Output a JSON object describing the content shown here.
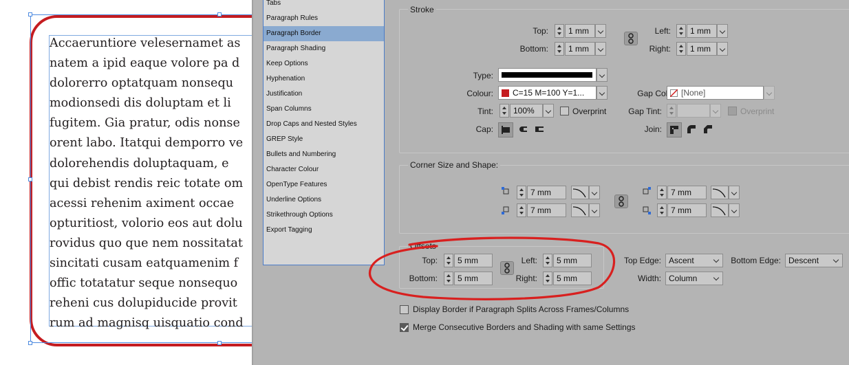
{
  "document": {
    "lines": [
      "Accaeruntiore velesernamet as",
      "natem a ipid eaque volore pa d",
      "dolorerro optatquam nonsequ",
      "modionsedi dis doluptam et li",
      "fugitem. Gia pratur, odis nonse",
      "orent labo. Itatqui demporro ve",
      "dolorehendis doluptaquam, e",
      "qui debist rendis reic totate om",
      "acessi rehenim aximent occae",
      "opturitiost, volorio eos aut dolu",
      "rovidus quo que nem nossitatat",
      "sincitati cusam eatquamenim f",
      "offic totatatur seque nonsequo",
      "reheni cus dolupiducide provit",
      "rum ad magnisq uisquatio cond"
    ],
    "border_color": "#c51c20"
  },
  "categories": {
    "items": [
      "Tabs",
      "Paragraph Rules",
      "Paragraph Border",
      "Paragraph Shading",
      "Keep Options",
      "Hyphenation",
      "Justification",
      "Span Columns",
      "Drop Caps and Nested Styles",
      "GREP Style",
      "Bullets and Numbering",
      "Character Colour",
      "OpenType Features",
      "Underline Options",
      "Strikethrough Options",
      "Export Tagging"
    ],
    "selected": "Paragraph Border"
  },
  "stroke": {
    "title": "Stroke",
    "top_label": "Top:",
    "top_value": "1 mm",
    "bottom_label": "Bottom:",
    "bottom_value": "1 mm",
    "left_label": "Left:",
    "left_value": "1 mm",
    "right_label": "Right:",
    "right_value": "1 mm",
    "type_label": "Type:",
    "colour_label": "Colour:",
    "colour_value": "C=15 M=100 Y=1...",
    "colour_swatch": "#c51c20",
    "tint_label": "Tint:",
    "tint_value": "100%",
    "overprint_label": "Overprint",
    "cap_label": "Cap:",
    "gap_colour_label": "Gap Colour:",
    "gap_colour_value": "[None]",
    "gap_tint_label": "Gap Tint:",
    "gap_overprint_label": "Overprint",
    "join_label": "Join:"
  },
  "corner": {
    "title": "Corner Size and Shape:",
    "tl_value": "7 mm",
    "bl_value": "7 mm",
    "tr_value": "7 mm",
    "br_value": "7 mm"
  },
  "offsets": {
    "title": "Offsets",
    "top_label": "Top:",
    "top_value": "5 mm",
    "bottom_label": "Bottom:",
    "bottom_value": "5 mm",
    "left_label": "Left:",
    "left_value": "5 mm",
    "right_label": "Right:",
    "right_value": "5 mm"
  },
  "edges": {
    "top_edge_label": "Top Edge:",
    "top_edge_value": "Ascent",
    "bottom_edge_label": "Bottom Edge:",
    "bottom_edge_value": "Descent",
    "width_label": "Width:",
    "width_value": "Column"
  },
  "options": {
    "display_border_label": "Display Border if Paragraph Splits Across Frames/Columns",
    "display_border_checked": false,
    "merge_label": "Merge Consecutive Borders and Shading with same Settings",
    "merge_checked": true
  },
  "annotation_color": "#d8201f"
}
